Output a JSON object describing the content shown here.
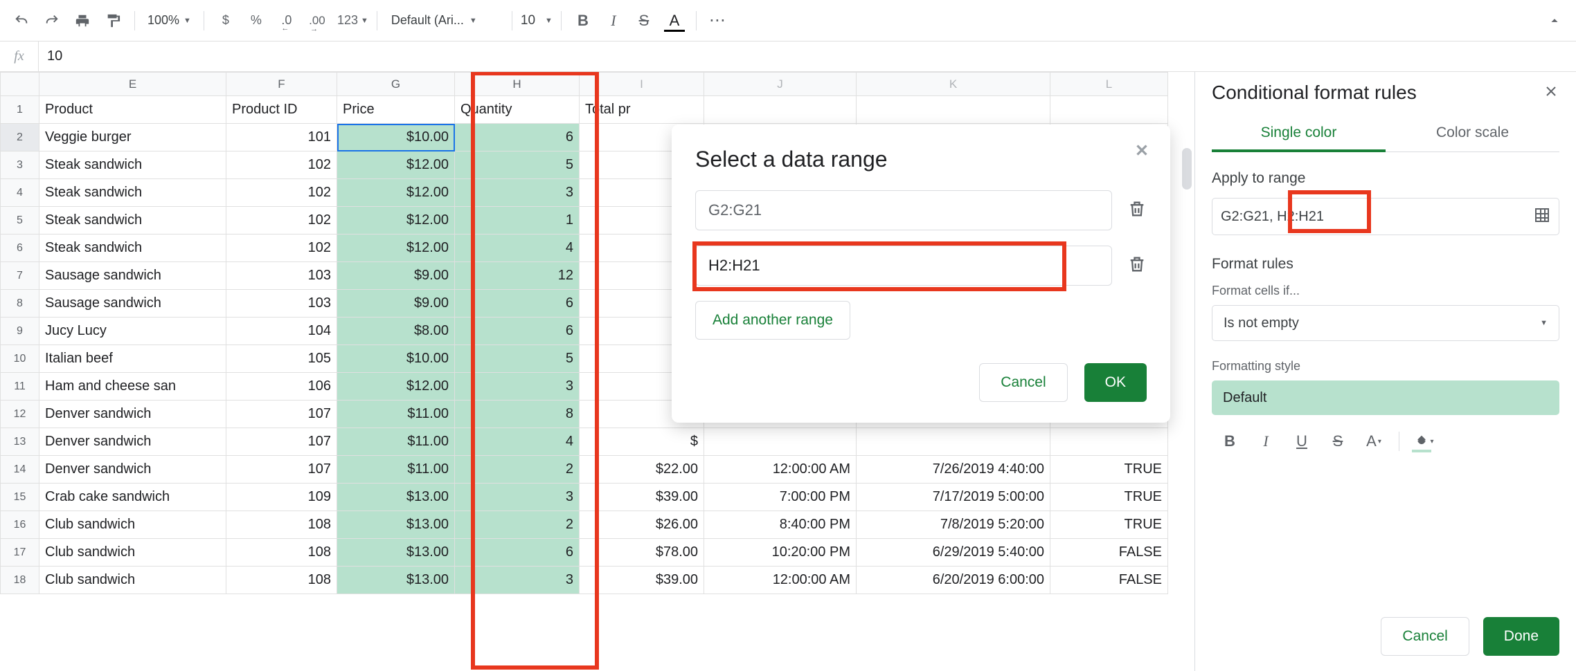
{
  "toolbar": {
    "zoom": "100%",
    "number_formats": {
      "dollar": "$",
      "percent": "%",
      "dec_minus": ".0",
      "dec_plus": ".00",
      "custom": "123"
    },
    "font": "Default (Ari...",
    "font_size": "10",
    "bold": "B",
    "italic": "I",
    "strike": "S",
    "textcolor": "A",
    "more": "⋯"
  },
  "formula_bar": {
    "value": "10"
  },
  "columns": [
    "E",
    "F",
    "G",
    "H",
    "I",
    "J",
    "K",
    "L"
  ],
  "headers": {
    "E": "Product",
    "F": "Product ID",
    "G": "Price",
    "H": "Quantity",
    "I": "Total pr",
    "J": "",
    "K": "",
    "L": ""
  },
  "rows": [
    {
      "n": 2,
      "E": "Veggie burger",
      "F": "101",
      "G": "$10.00",
      "H": "6",
      "I": "$",
      "J": "",
      "K": "",
      "L": ""
    },
    {
      "n": 3,
      "E": "Steak sandwich",
      "F": "102",
      "G": "$12.00",
      "H": "5",
      "I": "",
      "J": "",
      "K": "",
      "L": ""
    },
    {
      "n": 4,
      "E": "Steak sandwich",
      "F": "102",
      "G": "$12.00",
      "H": "3",
      "I": "",
      "J": "",
      "K": "",
      "L": ""
    },
    {
      "n": 5,
      "E": "Steak sandwich",
      "F": "102",
      "G": "$12.00",
      "H": "1",
      "I": "",
      "J": "",
      "K": "",
      "L": ""
    },
    {
      "n": 6,
      "E": "Steak sandwich",
      "F": "102",
      "G": "$12.00",
      "H": "4",
      "I": "",
      "J": "",
      "K": "",
      "L": ""
    },
    {
      "n": 7,
      "E": "Sausage sandwich",
      "F": "103",
      "G": "$9.00",
      "H": "12",
      "I": "$",
      "J": "",
      "K": "",
      "L": ""
    },
    {
      "n": 8,
      "E": "Sausage sandwich",
      "F": "103",
      "G": "$9.00",
      "H": "6",
      "I": "$",
      "J": "",
      "K": "",
      "L": ""
    },
    {
      "n": 9,
      "E": "Jucy Lucy",
      "F": "104",
      "G": "$8.00",
      "H": "6",
      "I": "$",
      "J": "",
      "K": "",
      "L": ""
    },
    {
      "n": 10,
      "E": "Italian beef",
      "F": "105",
      "G": "$10.00",
      "H": "5",
      "I": "$",
      "J": "",
      "K": "",
      "L": ""
    },
    {
      "n": 11,
      "E": "Ham and cheese san",
      "F": "106",
      "G": "$12.00",
      "H": "3",
      "I": "$",
      "J": "",
      "K": "",
      "L": ""
    },
    {
      "n": 12,
      "E": "Denver sandwich",
      "F": "107",
      "G": "$11.00",
      "H": "8",
      "I": "$",
      "J": "",
      "K": "",
      "L": ""
    },
    {
      "n": 13,
      "E": "Denver sandwich",
      "F": "107",
      "G": "$11.00",
      "H": "4",
      "I": "$",
      "J": "",
      "K": "",
      "L": ""
    },
    {
      "n": 14,
      "E": "Denver sandwich",
      "F": "107",
      "G": "$11.00",
      "H": "2",
      "I": "$22.00",
      "J": "12:00:00 AM",
      "K": "7/26/2019 4:40:00",
      "L": "TRUE"
    },
    {
      "n": 15,
      "E": "Crab cake sandwich",
      "F": "109",
      "G": "$13.00",
      "H": "3",
      "I": "$39.00",
      "J": "7:00:00 PM",
      "K": "7/17/2019 5:00:00",
      "L": "TRUE"
    },
    {
      "n": 16,
      "E": "Club sandwich",
      "F": "108",
      "G": "$13.00",
      "H": "2",
      "I": "$26.00",
      "J": "8:40:00 PM",
      "K": "7/8/2019 5:20:00",
      "L": "TRUE"
    },
    {
      "n": 17,
      "E": "Club sandwich",
      "F": "108",
      "G": "$13.00",
      "H": "6",
      "I": "$78.00",
      "J": "10:20:00 PM",
      "K": "6/29/2019 5:40:00",
      "L": "FALSE"
    },
    {
      "n": 18,
      "E": "Club sandwich",
      "F": "108",
      "G": "$13.00",
      "H": "3",
      "I": "$39.00",
      "J": "12:00:00 AM",
      "K": "6/20/2019 6:00:00",
      "L": "FALSE"
    }
  ],
  "dialog": {
    "title": "Select a data range",
    "ranges": [
      "G2:G21",
      "H2:H21"
    ],
    "add_label": "Add another range",
    "cancel": "Cancel",
    "ok": "OK"
  },
  "panel": {
    "title": "Conditional format rules",
    "tabs": {
      "single": "Single color",
      "scale": "Color scale"
    },
    "apply_label": "Apply to range",
    "range_text_a": "G2:G21",
    "range_text_b": "H2:H21",
    "rules_label": "Format rules",
    "cells_if": "Format cells if...",
    "condition": "Is not empty",
    "style_label": "Formatting style",
    "preview": "Default",
    "cancel": "Cancel",
    "done": "Done"
  }
}
